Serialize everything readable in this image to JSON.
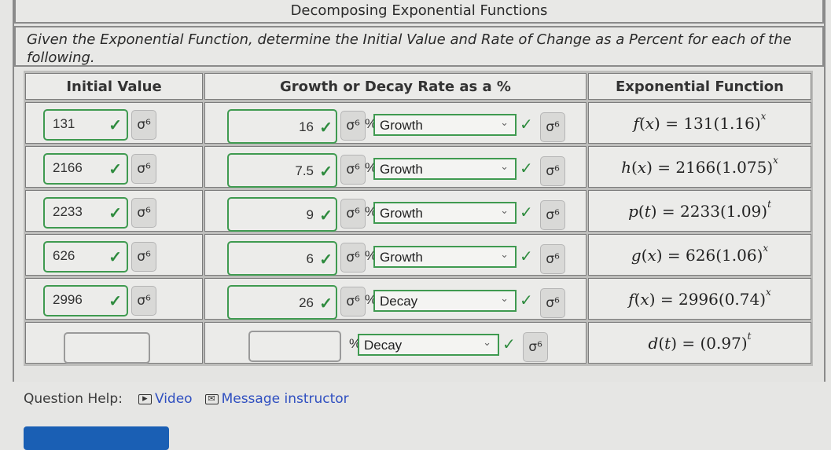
{
  "title": "Decomposing Exponential Functions",
  "instructions": "Given the Exponential Function, determine the Initial Value and Rate of Change as a Percent for each of the following.",
  "table": {
    "headers": [
      "Initial Value",
      "Growth or Decay Rate as a %",
      "Exponential Function"
    ],
    "rows": [
      {
        "initial_value": "131",
        "rate": "16",
        "type": "Growth",
        "iv_correct": true,
        "rate_correct": true,
        "type_correct": true,
        "func": {
          "name": "f",
          "var": "x",
          "coef": "131",
          "base": "1.16"
        }
      },
      {
        "initial_value": "2166",
        "rate": "7.5",
        "type": "Growth",
        "iv_correct": true,
        "rate_correct": true,
        "type_correct": true,
        "func": {
          "name": "h",
          "var": "x",
          "coef": "2166",
          "base": "1.075"
        }
      },
      {
        "initial_value": "2233",
        "rate": "9",
        "type": "Growth",
        "iv_correct": true,
        "rate_correct": true,
        "type_correct": true,
        "func": {
          "name": "p",
          "var": "t",
          "coef": "2233",
          "base": "1.09"
        }
      },
      {
        "initial_value": "626",
        "rate": "6",
        "type": "Growth",
        "iv_correct": true,
        "rate_correct": true,
        "type_correct": true,
        "func": {
          "name": "g",
          "var": "x",
          "coef": "626",
          "base": "1.06"
        }
      },
      {
        "initial_value": "2996",
        "rate": "26",
        "type": "Decay",
        "iv_correct": true,
        "rate_correct": true,
        "type_correct": true,
        "func": {
          "name": "f",
          "var": "x",
          "coef": "2996",
          "base": "0.74"
        }
      },
      {
        "initial_value": "",
        "rate": "",
        "type": "Decay",
        "iv_correct": false,
        "rate_correct": false,
        "type_correct": true,
        "func": {
          "name": "d",
          "var": "t",
          "coef": "",
          "base": "0.97"
        }
      }
    ]
  },
  "symbols": {
    "check": "✓",
    "hint": "σ⁶",
    "percent": "%",
    "chevron": "⌄",
    "video_icon": "▸",
    "mail_icon": "✉"
  },
  "help": {
    "label": "Question Help:",
    "video": "Video",
    "message": "Message instructor"
  },
  "colors": {
    "correct": "#2e8b3e",
    "link": "#2f4fc0",
    "submit": "#1a5fb4"
  }
}
